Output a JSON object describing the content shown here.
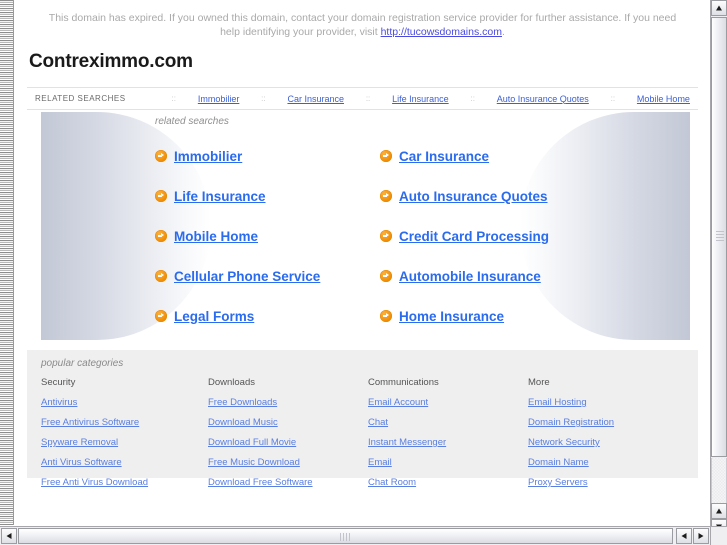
{
  "notice": {
    "text_before": "This domain has expired. If you owned this domain, contact your domain registration service provider for further assistance. If you need help identifying your provider, visit ",
    "link_text": "http://tucowsdomains.com",
    "text_after": "."
  },
  "site_title": "Contreximmo.com",
  "related_searches_bar": {
    "label": "RELATED SEARCHES",
    "separator": "::",
    "links": [
      "Immobilier",
      "Car Insurance",
      "Life Insurance",
      "Auto Insurance Quotes",
      "Mobile Home"
    ]
  },
  "hero": {
    "label": "related searches",
    "links": [
      "Immobilier",
      "Car Insurance",
      "Life Insurance",
      "Auto Insurance Quotes",
      "Mobile Home",
      "Credit Card Processing",
      "Cellular Phone Service",
      "Automobile Insurance",
      "Legal Forms",
      "Home Insurance"
    ]
  },
  "popular_categories": {
    "title": "popular categories",
    "columns": [
      {
        "heading": "Security",
        "links": [
          "Antivirus",
          "Free Antivirus Software",
          "Spyware Removal",
          "Anti Virus Software",
          "Free Anti Virus Download"
        ]
      },
      {
        "heading": "Downloads",
        "links": [
          "Free Downloads",
          "Download Music",
          "Download Full Movie",
          "Free Music Download",
          "Download Free Software"
        ]
      },
      {
        "heading": "Communications",
        "links": [
          "Email Account",
          "Chat",
          "Instant Messenger",
          "Email",
          "Chat Room"
        ]
      },
      {
        "heading": "More",
        "links": [
          "Email Hosting",
          "Domain Registration",
          "Network Security",
          "Domain Name",
          "Proxy Servers"
        ]
      }
    ]
  },
  "colors": {
    "link_blue": "#2b6bed",
    "bar_link_blue": "#3a5fd9",
    "bullet_orange": "#f08c00",
    "notice_gray": "#a9a9a9",
    "category_bg": "#efefef"
  },
  "scrollbars": {
    "vertical_icon_up": "triangle-up",
    "vertical_icon_down": "triangle-down",
    "horizontal_icon_left": "triangle-left",
    "horizontal_icon_right": "triangle-right"
  }
}
